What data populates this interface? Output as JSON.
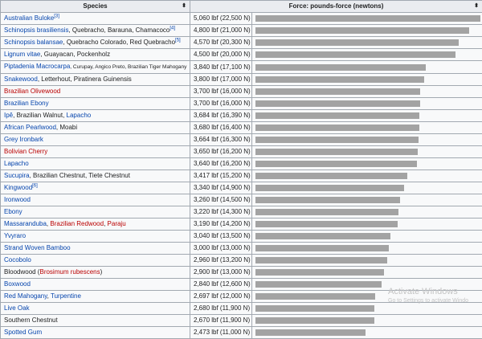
{
  "table": {
    "headers": {
      "species": "Species",
      "force": "Force: pounds-force (newtons)"
    },
    "sort_icon": "⬍",
    "bar_color": "#a3a3a3",
    "bar_scale_max": 5060,
    "rows": [
      {
        "parts": [
          {
            "t": "Australian Buloke",
            "c": "link"
          },
          {
            "t": "[3]",
            "c": "sup"
          }
        ],
        "force": "5,060 lbf (22,500 N)",
        "lbf": 5060
      },
      {
        "parts": [
          {
            "t": "Schinopsis brasiliensis",
            "c": "link"
          },
          {
            "t": ", Quebracho, Barauna, Chamacoco",
            "c": "plain"
          },
          {
            "t": "[4]",
            "c": "sup"
          }
        ],
        "force": "4,800 lbf (21,000 N)",
        "lbf": 4800
      },
      {
        "parts": [
          {
            "t": "Schinopsis balansae",
            "c": "link"
          },
          {
            "t": ", Quebracho Colorado, Red Quebracho",
            "c": "plain"
          },
          {
            "t": "[5]",
            "c": "sup"
          }
        ],
        "force": "4,570 lbf (20,300 N)",
        "lbf": 4570
      },
      {
        "parts": [
          {
            "t": "Lignum vitae",
            "c": "link"
          },
          {
            "t": ", Guayacan, Pockenholz",
            "c": "plain"
          }
        ],
        "force": "4,500 lbf (20,000 N)",
        "lbf": 4500
      },
      {
        "parts": [
          {
            "t": "Piptadenia Macrocarpa",
            "c": "link"
          },
          {
            "t": ", Curupay, Angico Preto, Brazilian Tiger Mahogany",
            "c": "small"
          }
        ],
        "force": "3,840 lbf (17,100 N)",
        "lbf": 3840
      },
      {
        "parts": [
          {
            "t": "Snakewood",
            "c": "link"
          },
          {
            "t": ", Letterhout, Piratinera Guinensis",
            "c": "plain"
          }
        ],
        "force": "3,800 lbf (17,000 N)",
        "lbf": 3800
      },
      {
        "parts": [
          {
            "t": "Brazilian Olivewood",
            "c": "redlink"
          }
        ],
        "force": "3,700 lbf (16,000 N)",
        "lbf": 3700
      },
      {
        "parts": [
          {
            "t": "Brazilian Ebony",
            "c": "link"
          }
        ],
        "force": "3,700 lbf (16,000 N)",
        "lbf": 3700
      },
      {
        "parts": [
          {
            "t": "Ipê",
            "c": "link"
          },
          {
            "t": ", Brazilian Walnut, ",
            "c": "plain"
          },
          {
            "t": "Lapacho",
            "c": "link"
          }
        ],
        "force": "3,684 lbf (16,390 N)",
        "lbf": 3684
      },
      {
        "parts": [
          {
            "t": "African Pearlwood",
            "c": "link"
          },
          {
            "t": ", Moabi",
            "c": "plain"
          }
        ],
        "force": "3,680 lbf (16,400 N)",
        "lbf": 3680
      },
      {
        "parts": [
          {
            "t": "Grey Ironbark",
            "c": "link"
          }
        ],
        "force": "3,664 lbf (16,300 N)",
        "lbf": 3664
      },
      {
        "parts": [
          {
            "t": "Bolivian Cherry",
            "c": "redlink"
          }
        ],
        "force": "3,650 lbf (16,200 N)",
        "lbf": 3650
      },
      {
        "parts": [
          {
            "t": "Lapacho",
            "c": "link"
          }
        ],
        "force": "3,640 lbf (16,200 N)",
        "lbf": 3640
      },
      {
        "parts": [
          {
            "t": "Sucupira",
            "c": "link"
          },
          {
            "t": ", Brazilian Chestnut, Tiete Chestnut",
            "c": "plain"
          }
        ],
        "force": "3,417 lbf (15,200 N)",
        "lbf": 3417
      },
      {
        "parts": [
          {
            "t": "Kingwood",
            "c": "link"
          },
          {
            "t": "[6]",
            "c": "sup"
          }
        ],
        "force": "3,340 lbf (14,900 N)",
        "lbf": 3340
      },
      {
        "parts": [
          {
            "t": "Ironwood",
            "c": "link"
          }
        ],
        "force": "3,260 lbf (14,500 N)",
        "lbf": 3260
      },
      {
        "parts": [
          {
            "t": "Ebony",
            "c": "link"
          }
        ],
        "force": "3,220 lbf (14,300 N)",
        "lbf": 3220
      },
      {
        "parts": [
          {
            "t": "Massaranduba",
            "c": "link"
          },
          {
            "t": ", ",
            "c": "plain"
          },
          {
            "t": "Brazilian Redwood",
            "c": "redlink"
          },
          {
            "t": ", ",
            "c": "plain"
          },
          {
            "t": "Paraju",
            "c": "redlink"
          }
        ],
        "force": "3,190 lbf (14,200 N)",
        "lbf": 3190
      },
      {
        "parts": [
          {
            "t": "Yvyraro",
            "c": "link"
          }
        ],
        "force": "3,040 lbf (13,500 N)",
        "lbf": 3040
      },
      {
        "parts": [
          {
            "t": "Strand Woven Bamboo",
            "c": "link"
          }
        ],
        "force": "3,000 lbf (13,000 N)",
        "lbf": 3000
      },
      {
        "parts": [
          {
            "t": "Cocobolo",
            "c": "link"
          }
        ],
        "force": "2,960 lbf (13,200 N)",
        "lbf": 2960
      },
      {
        "parts": [
          {
            "t": "Bloodwood (",
            "c": "plain"
          },
          {
            "t": "Brosimum rubescens",
            "c": "redlink"
          },
          {
            "t": ")",
            "c": "plain"
          }
        ],
        "force": "2,900 lbf (13,000 N)",
        "lbf": 2900
      },
      {
        "parts": [
          {
            "t": "Boxwood",
            "c": "link"
          }
        ],
        "force": "2,840 lbf (12,600 N)",
        "lbf": 2840
      },
      {
        "parts": [
          {
            "t": "Red Mahogany",
            "c": "link"
          },
          {
            "t": ", ",
            "c": "plain"
          },
          {
            "t": "Turpentine",
            "c": "link"
          }
        ],
        "force": "2,697 lbf (12,000 N)",
        "lbf": 2697
      },
      {
        "parts": [
          {
            "t": "Live Oak",
            "c": "link"
          }
        ],
        "force": "2,680 lbf (11,900 N)",
        "lbf": 2680
      },
      {
        "parts": [
          {
            "t": "Southern Chestnut",
            "c": "plain"
          }
        ],
        "force": "2,670 lbf (11,900 N)",
        "lbf": 2670
      },
      {
        "parts": [
          {
            "t": "Spotted Gum",
            "c": "link"
          }
        ],
        "force": "2,473 lbf (11,000 N)",
        "lbf": 2473
      }
    ]
  },
  "watermark": {
    "title": "Activate Windows",
    "subtitle": "Go to Settings to activate Windo"
  }
}
